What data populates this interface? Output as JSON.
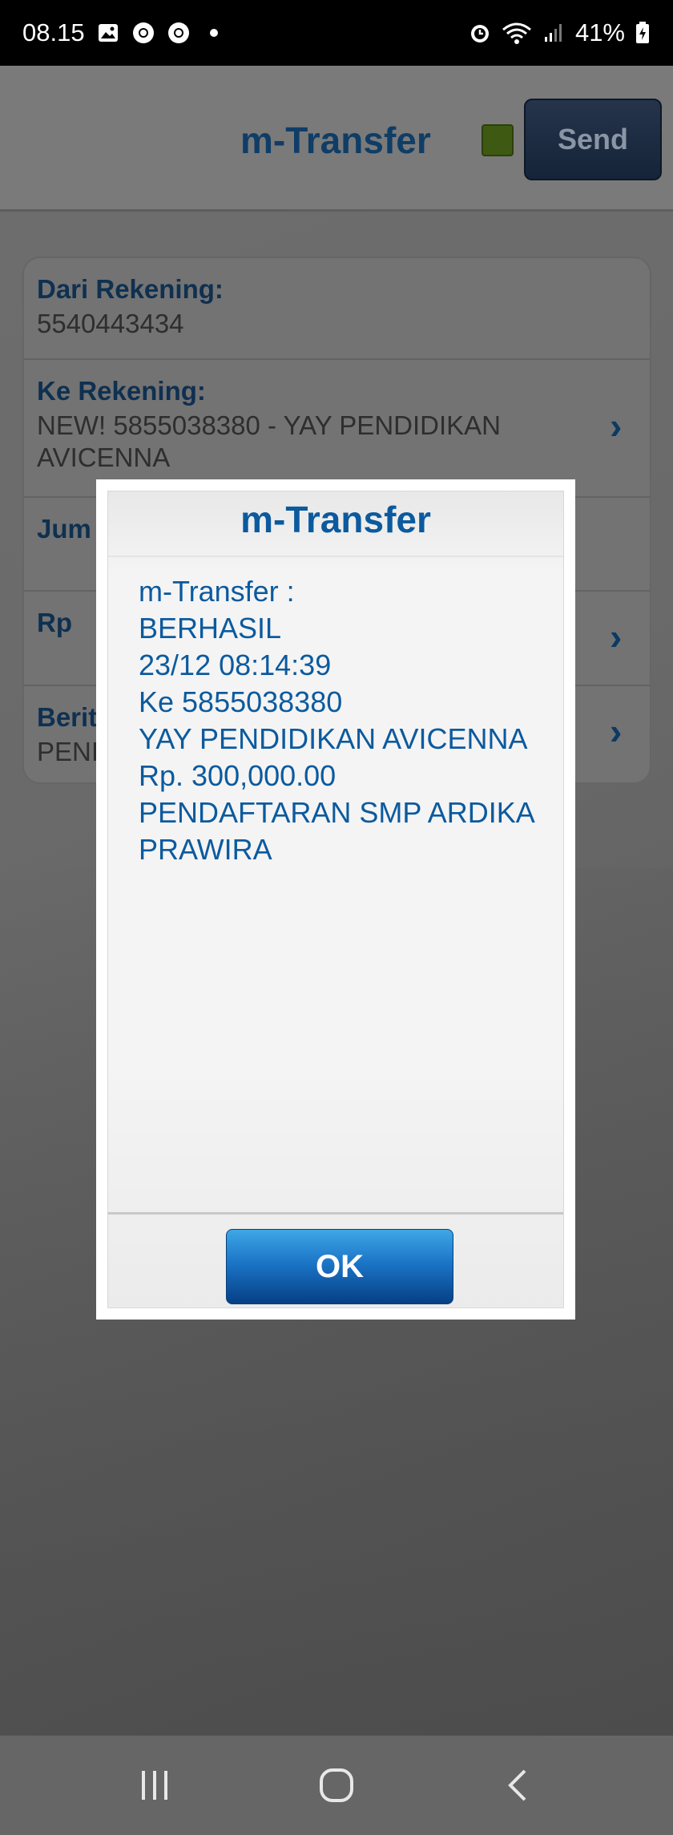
{
  "status_bar": {
    "time": "08.15",
    "battery": "41%",
    "icons_left": [
      "image-icon",
      "chrome-icon",
      "chrome-icon",
      "dot-icon"
    ],
    "icons_right": [
      "alarm-icon",
      "wifi-icon",
      "signal-icon",
      "battery-icon"
    ]
  },
  "header": {
    "title": "m-Transfer",
    "send_label": "Send",
    "status_color": "#3e5a12"
  },
  "form": {
    "dari": {
      "label": "Dari Rekening:",
      "value": "5540443434"
    },
    "ke": {
      "label": "Ke Rekening:",
      "value": "NEW! 5855038380 - YAY PENDIDIKAN AVICENNA"
    },
    "jumlah": {
      "label": "Jum"
    },
    "rp": {
      "label": "Rp"
    },
    "berita": {
      "label": "Berit",
      "value": "PENI"
    }
  },
  "dialog": {
    "title": "m-Transfer",
    "lines": [
      "m-Transfer :",
      "BERHASIL",
      "23/12 08:14:39",
      "Ke 5855038380",
      "YAY PENDIDIKAN AVICENNA",
      "Rp. 300,000.00",
      "PENDAFTARAN SMP ARDIKA PRAWIRA"
    ],
    "ok_label": "OK"
  },
  "colors": {
    "accent": "#0c5a9e",
    "ok_button": "#1b75c7"
  }
}
